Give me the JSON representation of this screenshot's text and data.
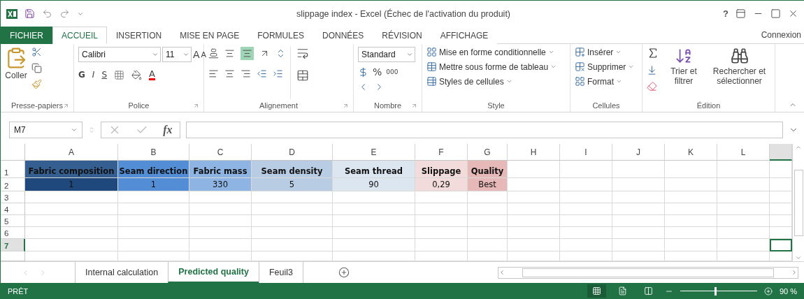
{
  "window": {
    "title": "slippage index - Excel (Échec de l'activation du produit)",
    "help": "?"
  },
  "ribbon_tabs": [
    {
      "label": "FICHIER",
      "kind": "file",
      "selected": false
    },
    {
      "label": "ACCUEIL",
      "kind": "tab",
      "selected": true
    },
    {
      "label": "INSERTION",
      "kind": "tab",
      "selected": false
    },
    {
      "label": "MISE EN PAGE",
      "kind": "tab",
      "selected": false
    },
    {
      "label": "FORMULES",
      "kind": "tab",
      "selected": false
    },
    {
      "label": "DONNÉES",
      "kind": "tab",
      "selected": false
    },
    {
      "label": "RÉVISION",
      "kind": "tab",
      "selected": false
    },
    {
      "label": "AFFICHAGE",
      "kind": "tab",
      "selected": false
    }
  ],
  "account": "Connexion",
  "ribbon_groups": [
    {
      "kind": "clipboard",
      "label": "Presse-papiers",
      "launcher": true,
      "paste": "Coller"
    },
    {
      "kind": "font",
      "label": "Police",
      "launcher": true,
      "font": "Calibri",
      "size": "11",
      "grow": "A",
      "shrink": "A",
      "bold": "G",
      "italic": "I",
      "underline": "S",
      "font_color": "A"
    },
    {
      "kind": "alignment",
      "label": "Alignement",
      "launcher": true
    },
    {
      "kind": "number",
      "label": "Nombre",
      "launcher": true,
      "format": "Standard",
      "percent": "%",
      "thousands": "000"
    },
    {
      "kind": "styles",
      "label": "Style",
      "launcher": false,
      "items": [
        "Mise en forme conditionnelle",
        "Mettre sous forme de tableau",
        "Styles de cellules"
      ]
    },
    {
      "kind": "cells",
      "label": "Cellules",
      "launcher": false,
      "items": [
        "Insérer",
        "Supprimer",
        "Format"
      ]
    },
    {
      "kind": "editing",
      "label": "Édition",
      "launcher": false,
      "items": [
        "Trier et filtrer",
        "Rechercher et sélectionner"
      ]
    }
  ],
  "formula_bar": {
    "name_box": "M7",
    "fx": "fx"
  },
  "sheet": {
    "columns": [
      {
        "label": "A",
        "selected": false
      },
      {
        "label": "B",
        "selected": false
      },
      {
        "label": "C",
        "selected": false
      },
      {
        "label": "D",
        "selected": false
      },
      {
        "label": "E",
        "selected": false
      },
      {
        "label": "F",
        "selected": false
      },
      {
        "label": "G",
        "selected": false
      },
      {
        "label": "H",
        "selected": false
      },
      {
        "label": "I",
        "selected": false
      },
      {
        "label": "J",
        "selected": false
      },
      {
        "label": "K",
        "selected": false
      },
      {
        "label": "L",
        "selected": false
      },
      {
        "selected": true
      }
    ],
    "rows": [
      {
        "number": "1",
        "selected": false,
        "cells": [
          {
            "text": "Fabric composition",
            "color": "#365f91",
            "bold": true
          },
          {
            "text": "Seam direction",
            "color": "#538dd5",
            "bold": true
          },
          {
            "text": "Fabric mass",
            "color": "#8db4e2",
            "bold": true
          },
          {
            "text": "Seam density",
            "color": "#b8cce4",
            "bold": true
          },
          {
            "text": "Seam thread",
            "color": "#dce6f1",
            "bold": true
          },
          {
            "text": "Slippage",
            "color": "#f2dcdb",
            "bold": true
          },
          {
            "text": "Quality",
            "color": "#e6b8b7",
            "bold": true
          }
        ]
      },
      {
        "number": "2",
        "selected": false,
        "cells": [
          {
            "text": "1",
            "color": "#1f497d",
            "bold": false
          },
          {
            "text": "1",
            "color": "#538dd5",
            "bold": false
          },
          {
            "text": "330",
            "color": "#8db4e2",
            "bold": false
          },
          {
            "text": "5",
            "color": "#b8cce4",
            "bold": false
          },
          {
            "text": "90",
            "color": "#dce6f1",
            "bold": false
          },
          {
            "text": "0,29",
            "color": "#f2dcdb",
            "bold": false
          },
          {
            "text": "Best",
            "color": "#e6b8b7",
            "bold": false
          }
        ]
      },
      {
        "number": "3",
        "selected": false
      },
      {
        "number": "4",
        "selected": false
      },
      {
        "number": "5",
        "selected": false
      },
      {
        "number": "6",
        "selected": false
      },
      {
        "number": "7",
        "selected": true
      }
    ]
  },
  "sheet_tabs": [
    {
      "label": "Internal calculation",
      "selected": false
    },
    {
      "label": "Predicted quality",
      "selected": true
    },
    {
      "label": "Feuil3",
      "selected": false
    }
  ],
  "status_bar": {
    "status": "PRÊT",
    "views": [
      {
        "kind": "normal",
        "selected": true
      },
      {
        "kind": "page_layout",
        "selected": false
      },
      {
        "kind": "page_break",
        "selected": false
      }
    ],
    "zoom": {
      "level": 0.45,
      "reading": "90 %"
    }
  }
}
